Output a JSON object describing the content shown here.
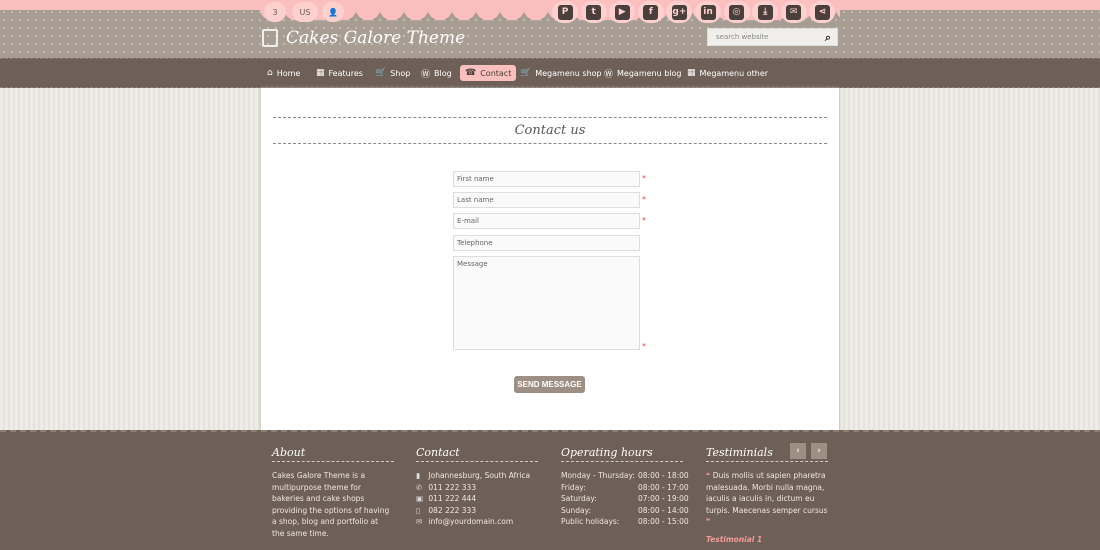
{
  "topbar": {
    "cart_count": "3",
    "language": "US",
    "user_icon": "user-icon",
    "social": [
      {
        "name": "pinterest-icon",
        "glyph": "P"
      },
      {
        "name": "twitter-icon",
        "glyph": "t"
      },
      {
        "name": "youtube-icon",
        "glyph": "▶"
      },
      {
        "name": "facebook-icon",
        "glyph": "f"
      },
      {
        "name": "google-plus-icon",
        "glyph": "g+"
      },
      {
        "name": "linkedin-icon",
        "glyph": "in"
      },
      {
        "name": "instagram-icon",
        "glyph": "◎"
      },
      {
        "name": "download-icon",
        "glyph": "⤓"
      },
      {
        "name": "email-icon",
        "glyph": "✉"
      },
      {
        "name": "share-icon",
        "glyph": "⋖"
      }
    ]
  },
  "header": {
    "logo": "Cakes Galore Theme",
    "search_placeholder": "search website"
  },
  "nav": [
    {
      "label": "Home",
      "icon": "⌂"
    },
    {
      "label": "Features",
      "icon": "▦"
    },
    {
      "label": "Shop",
      "icon": "🛒"
    },
    {
      "label": "Blog",
      "icon": "Ⓦ"
    },
    {
      "label": "Contact",
      "icon": "☎"
    },
    {
      "label": "Megamenu shop",
      "icon": "🛒"
    },
    {
      "label": "Megamenu blog",
      "icon": "Ⓦ"
    },
    {
      "label": "Megamenu other",
      "icon": "▦"
    }
  ],
  "main": {
    "title": "Contact us",
    "fields": {
      "first_name": "First name",
      "last_name": "Last name",
      "email": "E-mail",
      "telephone": "Telephone",
      "message": "Message"
    },
    "required": "*",
    "send": "SEND MESSAGE"
  },
  "footer": {
    "about": {
      "title": "About",
      "text": "Cakes Galore Theme is a multipurpose theme for bakeries and cake shops providing the options of having a shop, blog and portfolio at the same time."
    },
    "contact": {
      "title": "Contact",
      "address": "Johannesburg, South Africa",
      "phone": "011 222 333",
      "fax": "011 222 444",
      "mobile": "082 222 333",
      "email": "info@yourdomain.com"
    },
    "hours": {
      "title": "Operating hours",
      "rows": [
        {
          "day": "Monday - Thursday:",
          "time": "08:00 - 18:00"
        },
        {
          "day": "Friday:",
          "time": "08:00 - 17:00"
        },
        {
          "day": "Saturday:",
          "time": "07:00 - 19:00"
        },
        {
          "day": "Sunday:",
          "time": "08:00 - 14:00"
        },
        {
          "day": "Public holidays:",
          "time": "08:00 - 15:00"
        }
      ]
    },
    "testimonials": {
      "title": "Testiminials",
      "text": "Duis mollis ut sapien pharetra malesuada. Morbi nulla magna, iaculis a iaculis in, dictum eu turpis. Maecenas semper cursus",
      "author": "Testimonial 1",
      "prev": "‹",
      "next": "›"
    }
  }
}
